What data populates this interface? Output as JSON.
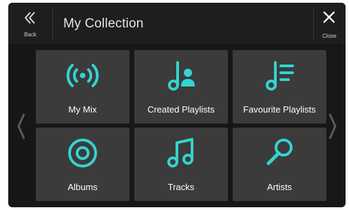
{
  "header": {
    "back_label": "Back",
    "title": "My Collection",
    "close_label": "Close",
    "back_icon": "double-chevron-left-icon",
    "close_icon": "close-icon"
  },
  "colors": {
    "accent": "#33d4cf",
    "tile": "#3b3b3b",
    "background": "#171717"
  },
  "tiles": [
    {
      "label": "My Mix",
      "icon": "radio-broadcast-icon"
    },
    {
      "label": "Created Playlists",
      "icon": "music-note-person-icon"
    },
    {
      "label": "Favourite Playlists",
      "icon": "music-note-list-icon"
    },
    {
      "label": "Albums",
      "icon": "disc-icon"
    },
    {
      "label": "Tracks",
      "icon": "double-music-note-icon"
    },
    {
      "label": "Artists",
      "icon": "microphone-icon"
    }
  ],
  "nav": {
    "prev_icon": "chevron-left-icon",
    "next_icon": "chevron-right-icon"
  }
}
